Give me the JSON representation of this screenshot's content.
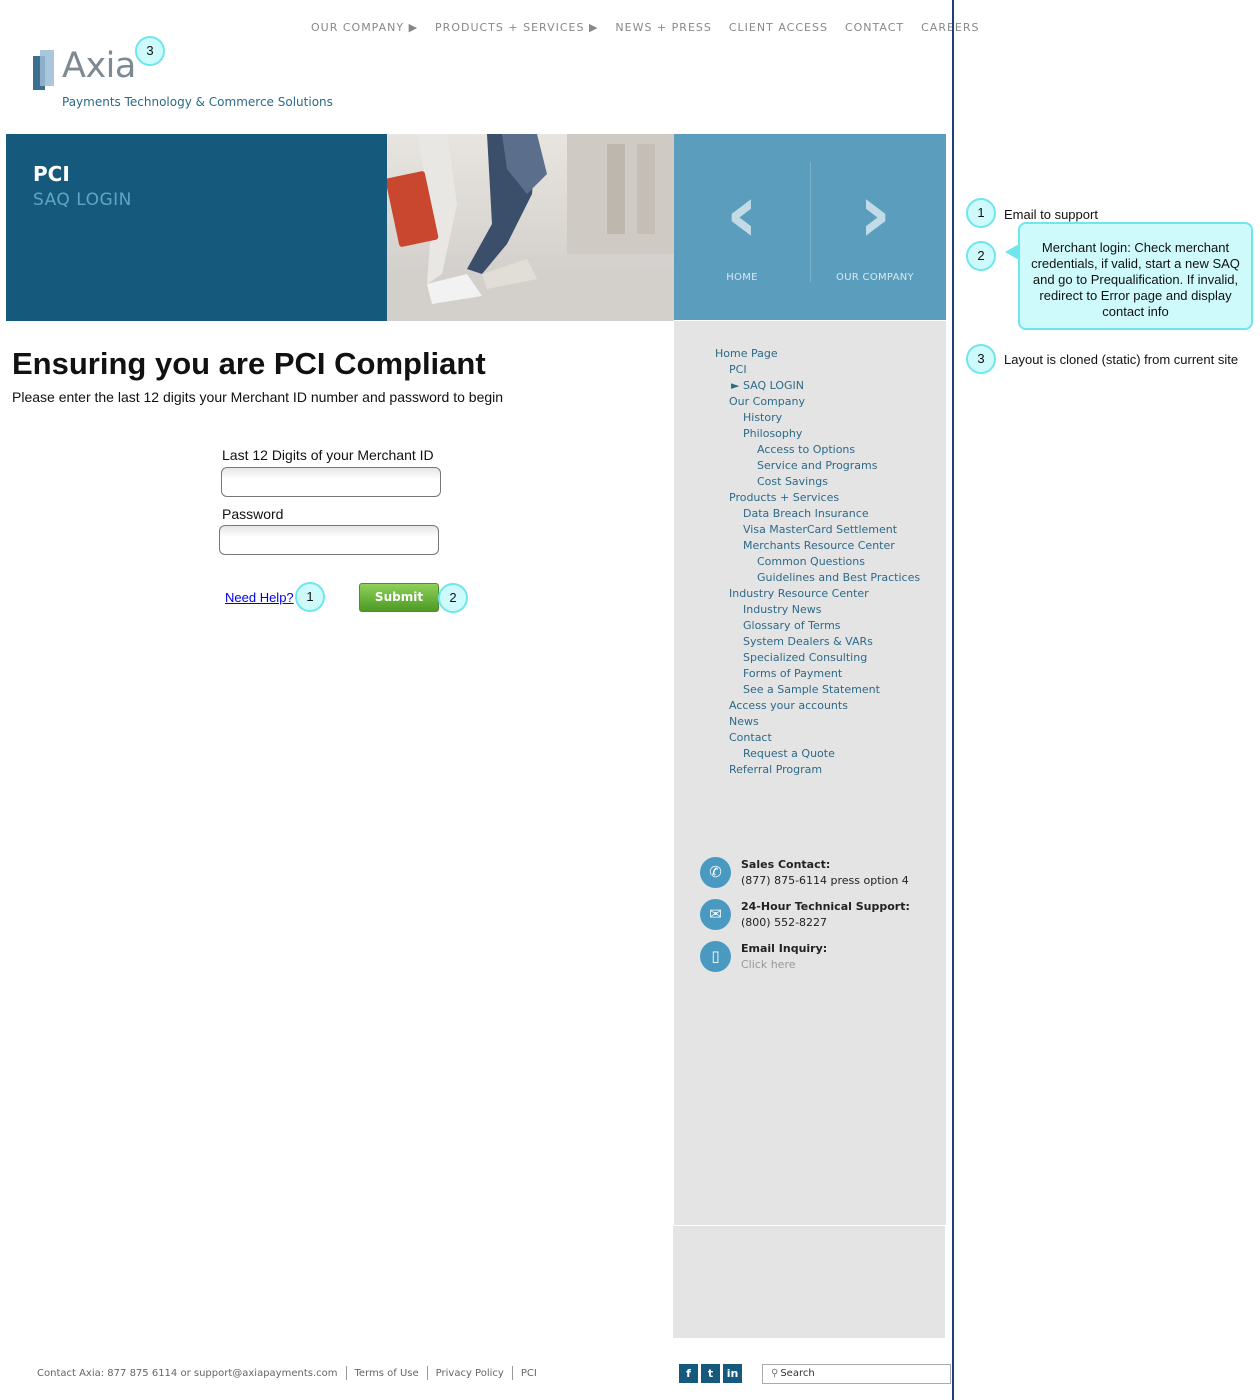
{
  "topnav": {
    "items": [
      "OUR COMPANY ▶",
      "PRODUCTS + SERVICES ▶",
      "NEWS + PRESS",
      "CLIENT ACCESS",
      "CONTACT",
      "CAREERS"
    ]
  },
  "logo": {
    "text": "Axia",
    "tagline": "Payments Technology & Commerce Solutions"
  },
  "hero": {
    "title": "PCI",
    "subtitle": "SAQ LOGIN",
    "nav": {
      "prev_label": "HOME",
      "next_label": "OUR COMPANY",
      "prev_glyph": "‹",
      "next_glyph": "›"
    }
  },
  "main": {
    "headline": "Ensuring you are PCI Compliant",
    "instructions": "Please enter the last 12 digits your Merchant ID number and password to begin",
    "merchant_label": "Last 12 Digits of your Merchant ID",
    "merchant_value": "",
    "password_label": "Password",
    "password_value": "",
    "help_link": "Need Help?",
    "submit_label": "Submit"
  },
  "markers": {
    "m1": "1",
    "m2": "2",
    "m3": "3"
  },
  "sidebar": {
    "tree": [
      "Home Page",
      "PCI",
      "► SAQ LOGIN",
      "Our Company",
      "History",
      "Philosophy",
      "Access to Options",
      "Service and Programs",
      "Cost Savings",
      "Products + Services",
      "Data Breach Insurance",
      "Visa MasterCard Settlement",
      "Merchants Resource Center",
      "Common Questions",
      "Guidelines and Best Practices",
      "Industry Resource Center",
      "Industry News",
      "Glossary of Terms",
      "System Dealers & VARs",
      "Specialized Consulting",
      "Forms of Payment",
      "See a Sample Statement",
      "Access your accounts",
      "News",
      "Contact",
      "Request a Quote",
      "Referral Program"
    ],
    "contacts": [
      {
        "title": "Sales Contact:",
        "value": "(877) 875-6114 press option 4",
        "icon": "phone-icon",
        "glyph": "✆"
      },
      {
        "title": "24-Hour Technical Support:",
        "value": "(800) 552-8227",
        "icon": "chat-icon",
        "glyph": "✉"
      },
      {
        "title": "Email Inquiry:",
        "value": "Click here",
        "icon": "mail-icon",
        "glyph": "▯"
      }
    ]
  },
  "footer": {
    "contact": "Contact Axia: 877 875 6114 or support@axiapayments.com",
    "terms": "Terms of Use",
    "privacy": "Privacy Policy",
    "pci": "PCI",
    "social": {
      "facebook": "f",
      "twitter": "t",
      "linkedin": "in"
    },
    "search_placeholder": "Search"
  },
  "annotations": {
    "note1": "Email to support",
    "note2": "Merchant login: Check merchant credentials, if valid, start a new SAQ and go to Prequalification. If invalid, redirect to Error page and display contact info",
    "note3": "Layout is cloned (static) from current site"
  }
}
